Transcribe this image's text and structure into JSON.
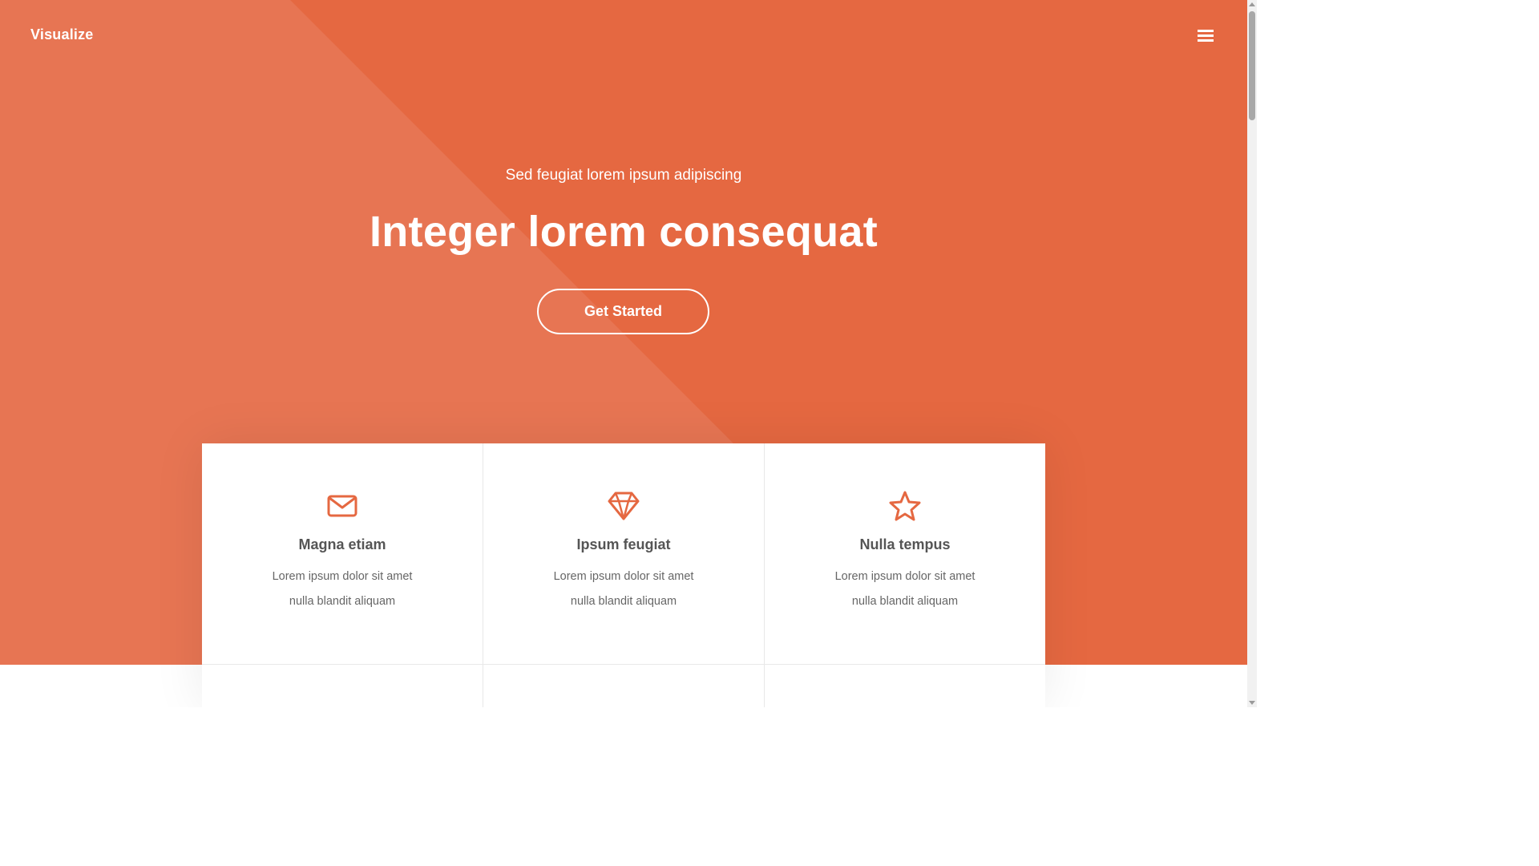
{
  "header": {
    "brand": "Visualize",
    "menu_icon": "hamburger-menu-icon"
  },
  "hero": {
    "subtitle": "Sed feugiat lorem ipsum adipiscing",
    "title": "Integer lorem consequat",
    "cta_label": "Get Started"
  },
  "colors": {
    "accent": "#e56841",
    "accent_light": "#e77553",
    "card_bg": "#ffffff",
    "heading_text": "#555555",
    "body_text": "#666666"
  },
  "features": [
    {
      "icon": "envelope-icon",
      "title": "Magna etiam",
      "line1": "Lorem ipsum dolor sit amet",
      "line2": "nulla blandit aliquam"
    },
    {
      "icon": "diamond-icon",
      "title": "Ipsum feugiat",
      "line1": "Lorem ipsum dolor sit amet",
      "line2": "nulla blandit aliquam"
    },
    {
      "icon": "star-icon",
      "title": "Nulla tempus",
      "line1": "Lorem ipsum dolor sit amet",
      "line2": "nulla blandit aliquam"
    }
  ]
}
